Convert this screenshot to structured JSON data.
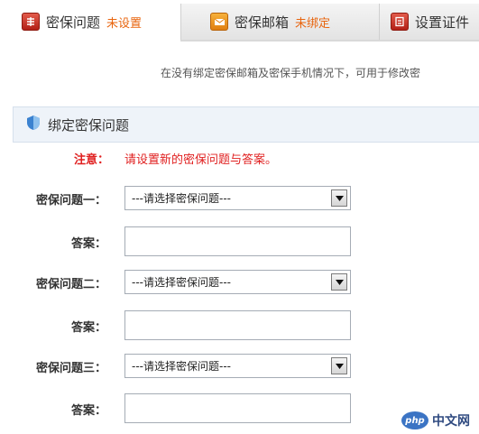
{
  "tabs": [
    {
      "label": "密保问题",
      "status": "未设置",
      "icon": "security-question-icon"
    },
    {
      "label": "密保邮箱",
      "status": "未绑定",
      "icon": "security-email-icon"
    },
    {
      "label": "设置证件",
      "status": "",
      "icon": "id-card-icon"
    }
  ],
  "notice": "在没有绑定密保邮箱及密保手机情况下，可用于修改密",
  "section": {
    "title": "绑定密保问题",
    "icon": "shield-icon"
  },
  "note": {
    "label": "注意：",
    "text": "请设置新的密保问题与答案。"
  },
  "questions": [
    {
      "label": "密保问题一：",
      "selected": "---请选择密保问题---",
      "answer_label": "答案：",
      "answer_value": ""
    },
    {
      "label": "密保问题二：",
      "selected": "---请选择密保问题---",
      "answer_label": "答案：",
      "answer_value": ""
    },
    {
      "label": "密保问题三：",
      "selected": "---请选择密保问题---",
      "answer_label": "答案：",
      "answer_value": ""
    }
  ],
  "watermark": {
    "logo": "php",
    "text": "中文网"
  },
  "colors": {
    "status_orange": "#e8650f",
    "notice_red": "#e02020",
    "header_bg": "#eef3f9"
  }
}
